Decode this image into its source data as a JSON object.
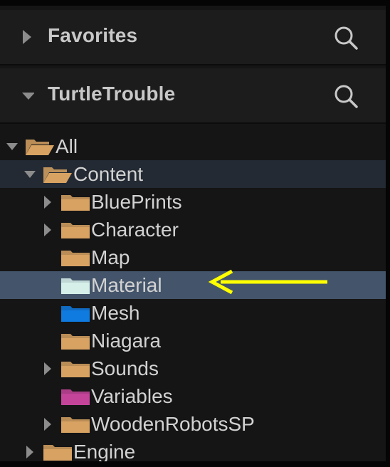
{
  "sections": {
    "favorites": {
      "title": "Favorites",
      "expanded": false
    },
    "project": {
      "title": "TurtleTrouble",
      "expanded": true
    }
  },
  "tree": [
    {
      "label": "All",
      "depth": 0,
      "expander": "expanded",
      "icon": "folder-open-icon",
      "color": "#d7a262",
      "state": "normal"
    },
    {
      "label": "Content",
      "depth": 1,
      "expander": "expanded",
      "icon": "folder-open-icon",
      "color": "#d7a262",
      "state": "parent-highlight"
    },
    {
      "label": "BluePrints",
      "depth": 2,
      "expander": "collapsed",
      "icon": "folder-icon",
      "color": "#d7a262",
      "state": "normal"
    },
    {
      "label": "Character",
      "depth": 2,
      "expander": "collapsed",
      "icon": "folder-icon",
      "color": "#d7a262",
      "state": "normal"
    },
    {
      "label": "Map",
      "depth": 2,
      "expander": "none",
      "icon": "folder-icon",
      "color": "#d7a262",
      "state": "normal"
    },
    {
      "label": "Material",
      "depth": 2,
      "expander": "none",
      "icon": "folder-icon",
      "color": "#d6efe8",
      "state": "selected"
    },
    {
      "label": "Mesh",
      "depth": 2,
      "expander": "none",
      "icon": "folder-icon",
      "color": "#0f7ae0",
      "state": "normal"
    },
    {
      "label": "Niagara",
      "depth": 2,
      "expander": "none",
      "icon": "folder-icon",
      "color": "#d7a262",
      "state": "normal"
    },
    {
      "label": "Sounds",
      "depth": 2,
      "expander": "collapsed",
      "icon": "folder-icon",
      "color": "#d7a262",
      "state": "normal"
    },
    {
      "label": "Variables",
      "depth": 2,
      "expander": "none",
      "icon": "folder-icon",
      "color": "#c4449a",
      "state": "normal"
    },
    {
      "label": "WoodenRobotsSP",
      "depth": 2,
      "expander": "collapsed",
      "icon": "folder-icon",
      "color": "#d7a262",
      "state": "normal"
    },
    {
      "label": "Engine",
      "depth": 1,
      "expander": "collapsed",
      "icon": "folder-icon",
      "color": "#d7a262",
      "state": "normal"
    }
  ],
  "colors": {
    "background": "#151515",
    "header_background": "#1c1c1c",
    "selection": "#44556b",
    "parent_highlight": "#232a33",
    "text": "#d2d2d2",
    "expander": "#8c8c8c",
    "annotation_arrow": "#ffff00"
  },
  "annotation": {
    "icon": "arrow-left-icon",
    "target": "Material",
    "color": "#ffff00"
  }
}
